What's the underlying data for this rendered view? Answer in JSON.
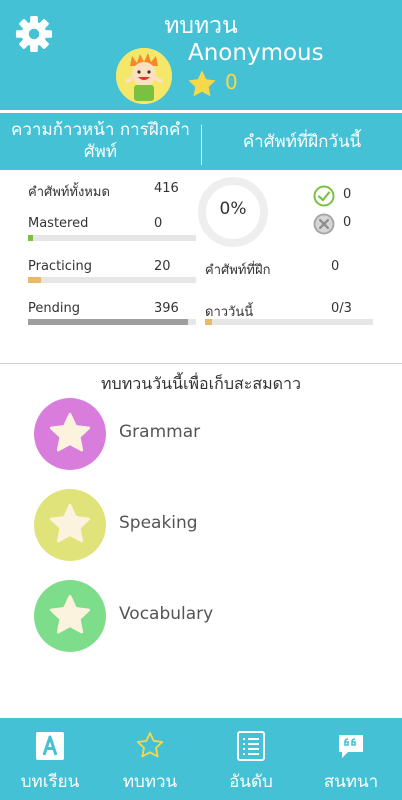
{
  "header": {
    "title": "ทบทวน",
    "username": "Anonymous",
    "star_count": "0"
  },
  "tabs": {
    "left": "ความก้าวหน้า การฝึกคำศัพท์",
    "right": "คำศัพท์ที่ฝึกวันนี้"
  },
  "stats": {
    "total": {
      "label": "คำศัพท์ทั้งหมด",
      "value": "416"
    },
    "mastered": {
      "label": "Mastered",
      "value": "0",
      "progress": 0.03
    },
    "practicing": {
      "label": "Practicing",
      "value": "20",
      "progress": 0.08
    },
    "pending": {
      "label": "Pending",
      "value": "396",
      "progress": 0.95
    },
    "percent": "0%",
    "correct_count": "0",
    "wrong_count": "0",
    "today_words": {
      "label": "คำศัพท์ที่ฝึก",
      "value": "0"
    },
    "today_stars": {
      "label": "ดาววันนี้",
      "value": "0/3",
      "progress": 0.04
    }
  },
  "colors": {
    "header": "#45c1d6",
    "mastered": "#7ac142",
    "practicing": "#e8b966",
    "pending": "#9e9e9e",
    "grammar": "#d97ddc",
    "speaking": "#dfe37a",
    "vocabulary": "#7ddd8a",
    "star_gold": "#f7d846"
  },
  "review": {
    "title": "ทบทวนวันนี้เพื่อเก็บสะสมดาว",
    "categories": [
      {
        "name": "Grammar"
      },
      {
        "name": "Speaking"
      },
      {
        "name": "Vocabulary"
      }
    ]
  },
  "nav": [
    {
      "label": "บทเรียน",
      "icon": "lesson-a-icon"
    },
    {
      "label": "ทบทวน",
      "icon": "star-outline-icon"
    },
    {
      "label": "อันดับ",
      "icon": "ranking-list-icon"
    },
    {
      "label": "สนทนา",
      "icon": "chat-quote-icon"
    }
  ]
}
